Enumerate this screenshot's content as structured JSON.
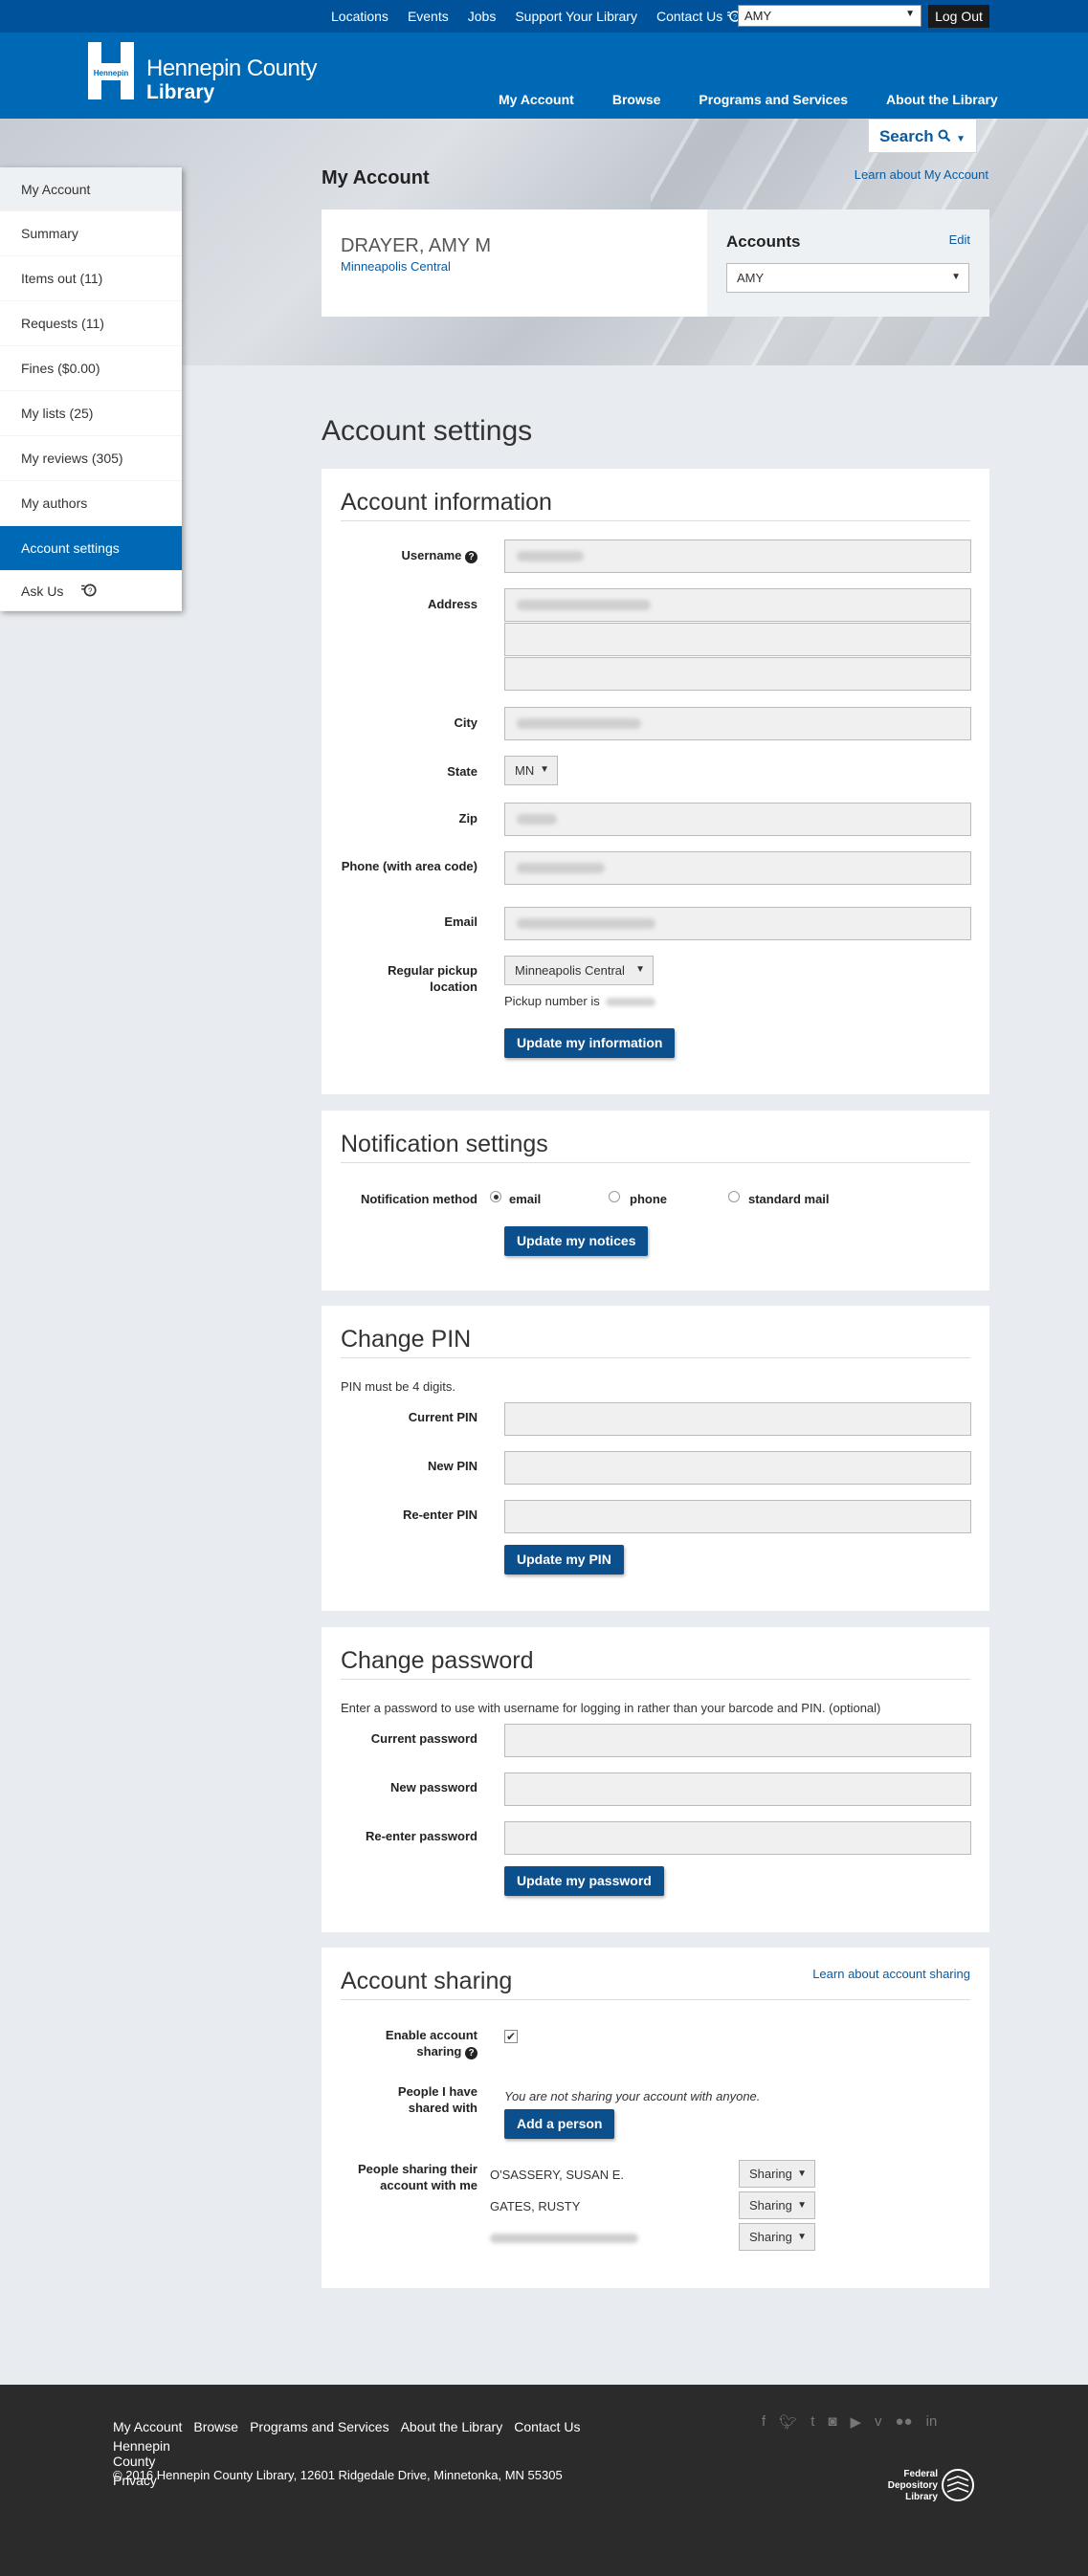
{
  "topbar": {
    "links": [
      "Locations",
      "Events",
      "Jobs",
      "Support Your Library",
      "Contact Us"
    ],
    "account_select": "AMY",
    "logout": "Log Out"
  },
  "header": {
    "logo_mark": "Hennepin",
    "logo_line1": "Hennepin County",
    "logo_line2": "Library",
    "nav": [
      "My Account",
      "Browse",
      "Programs and Services",
      "About the Library"
    ]
  },
  "hero": {
    "search": "Search",
    "title": "My Account",
    "learn": "Learn about My Account",
    "name": "DRAYER, AMY M",
    "branch": "Minneapolis Central",
    "accounts_label": "Accounts",
    "edit": "Edit",
    "accounts_select": "AMY"
  },
  "sidebar": {
    "head": "My Account",
    "items": [
      "Summary",
      "Items out (11)",
      "Requests (11)",
      "Fines ($0.00)",
      "My lists (25)",
      "My reviews (305)",
      "My authors"
    ],
    "active": "Account settings",
    "ask": "Ask Us"
  },
  "page_title": "Account settings",
  "account_info": {
    "heading": "Account information",
    "username_label": "Username",
    "address_label": "Address",
    "city_label": "City",
    "state_label": "State",
    "state_value": "MN",
    "zip_label": "Zip",
    "phone_label": "Phone (with area code)",
    "email_label": "Email",
    "pickup_label": "Regular pickup location",
    "pickup_value": "Minneapolis Central",
    "pickup_number_text": "Pickup number is",
    "button": "Update my information"
  },
  "notifications": {
    "heading": "Notification settings",
    "method_label": "Notification method",
    "options": [
      "email",
      "phone",
      "standard mail"
    ],
    "selected": "email",
    "button": "Update my notices"
  },
  "pin": {
    "heading": "Change PIN",
    "note": "PIN must be 4 digits.",
    "current": "Current PIN",
    "new": "New PIN",
    "reenter": "Re-enter PIN",
    "button": "Update my PIN"
  },
  "password": {
    "heading": "Change password",
    "note": "Enter a password to use with username for logging in rather than your barcode and PIN. (optional)",
    "current": "Current password",
    "new": "New password",
    "reenter": "Re-enter password",
    "button": "Update my password"
  },
  "sharing": {
    "heading": "Account sharing",
    "learn": "Learn about account sharing",
    "enable_label": "Enable account sharing",
    "shared_label": "People I have shared with",
    "shared_none": "You are not sharing your account with anyone.",
    "add_button": "Add a person",
    "sharing_with_me_label": "People sharing their account with me",
    "people": [
      {
        "name": "O'SASSERY, SUSAN E.",
        "status": "Sharing"
      },
      {
        "name": "GATES, RUSTY",
        "status": "Sharing"
      },
      {
        "name": "",
        "status": "Sharing"
      }
    ]
  },
  "footer": {
    "links": [
      "My Account",
      "Browse",
      "Programs and Services",
      "About the Library",
      "Contact Us",
      "Hennepin County",
      "Privacy"
    ],
    "copyright": "© 2016 Hennepin County Library, 12601 Ridgedale Drive, Minnetonka, MN 55305",
    "social": [
      "facebook-icon",
      "twitter-icon",
      "tumblr-icon",
      "instagram-icon",
      "youtube-icon",
      "vimeo-icon",
      "flickr-icon",
      "linkedin-icon"
    ],
    "fdl_line1": "Federal",
    "fdl_line2": "Depository",
    "fdl_line3": "Library"
  }
}
